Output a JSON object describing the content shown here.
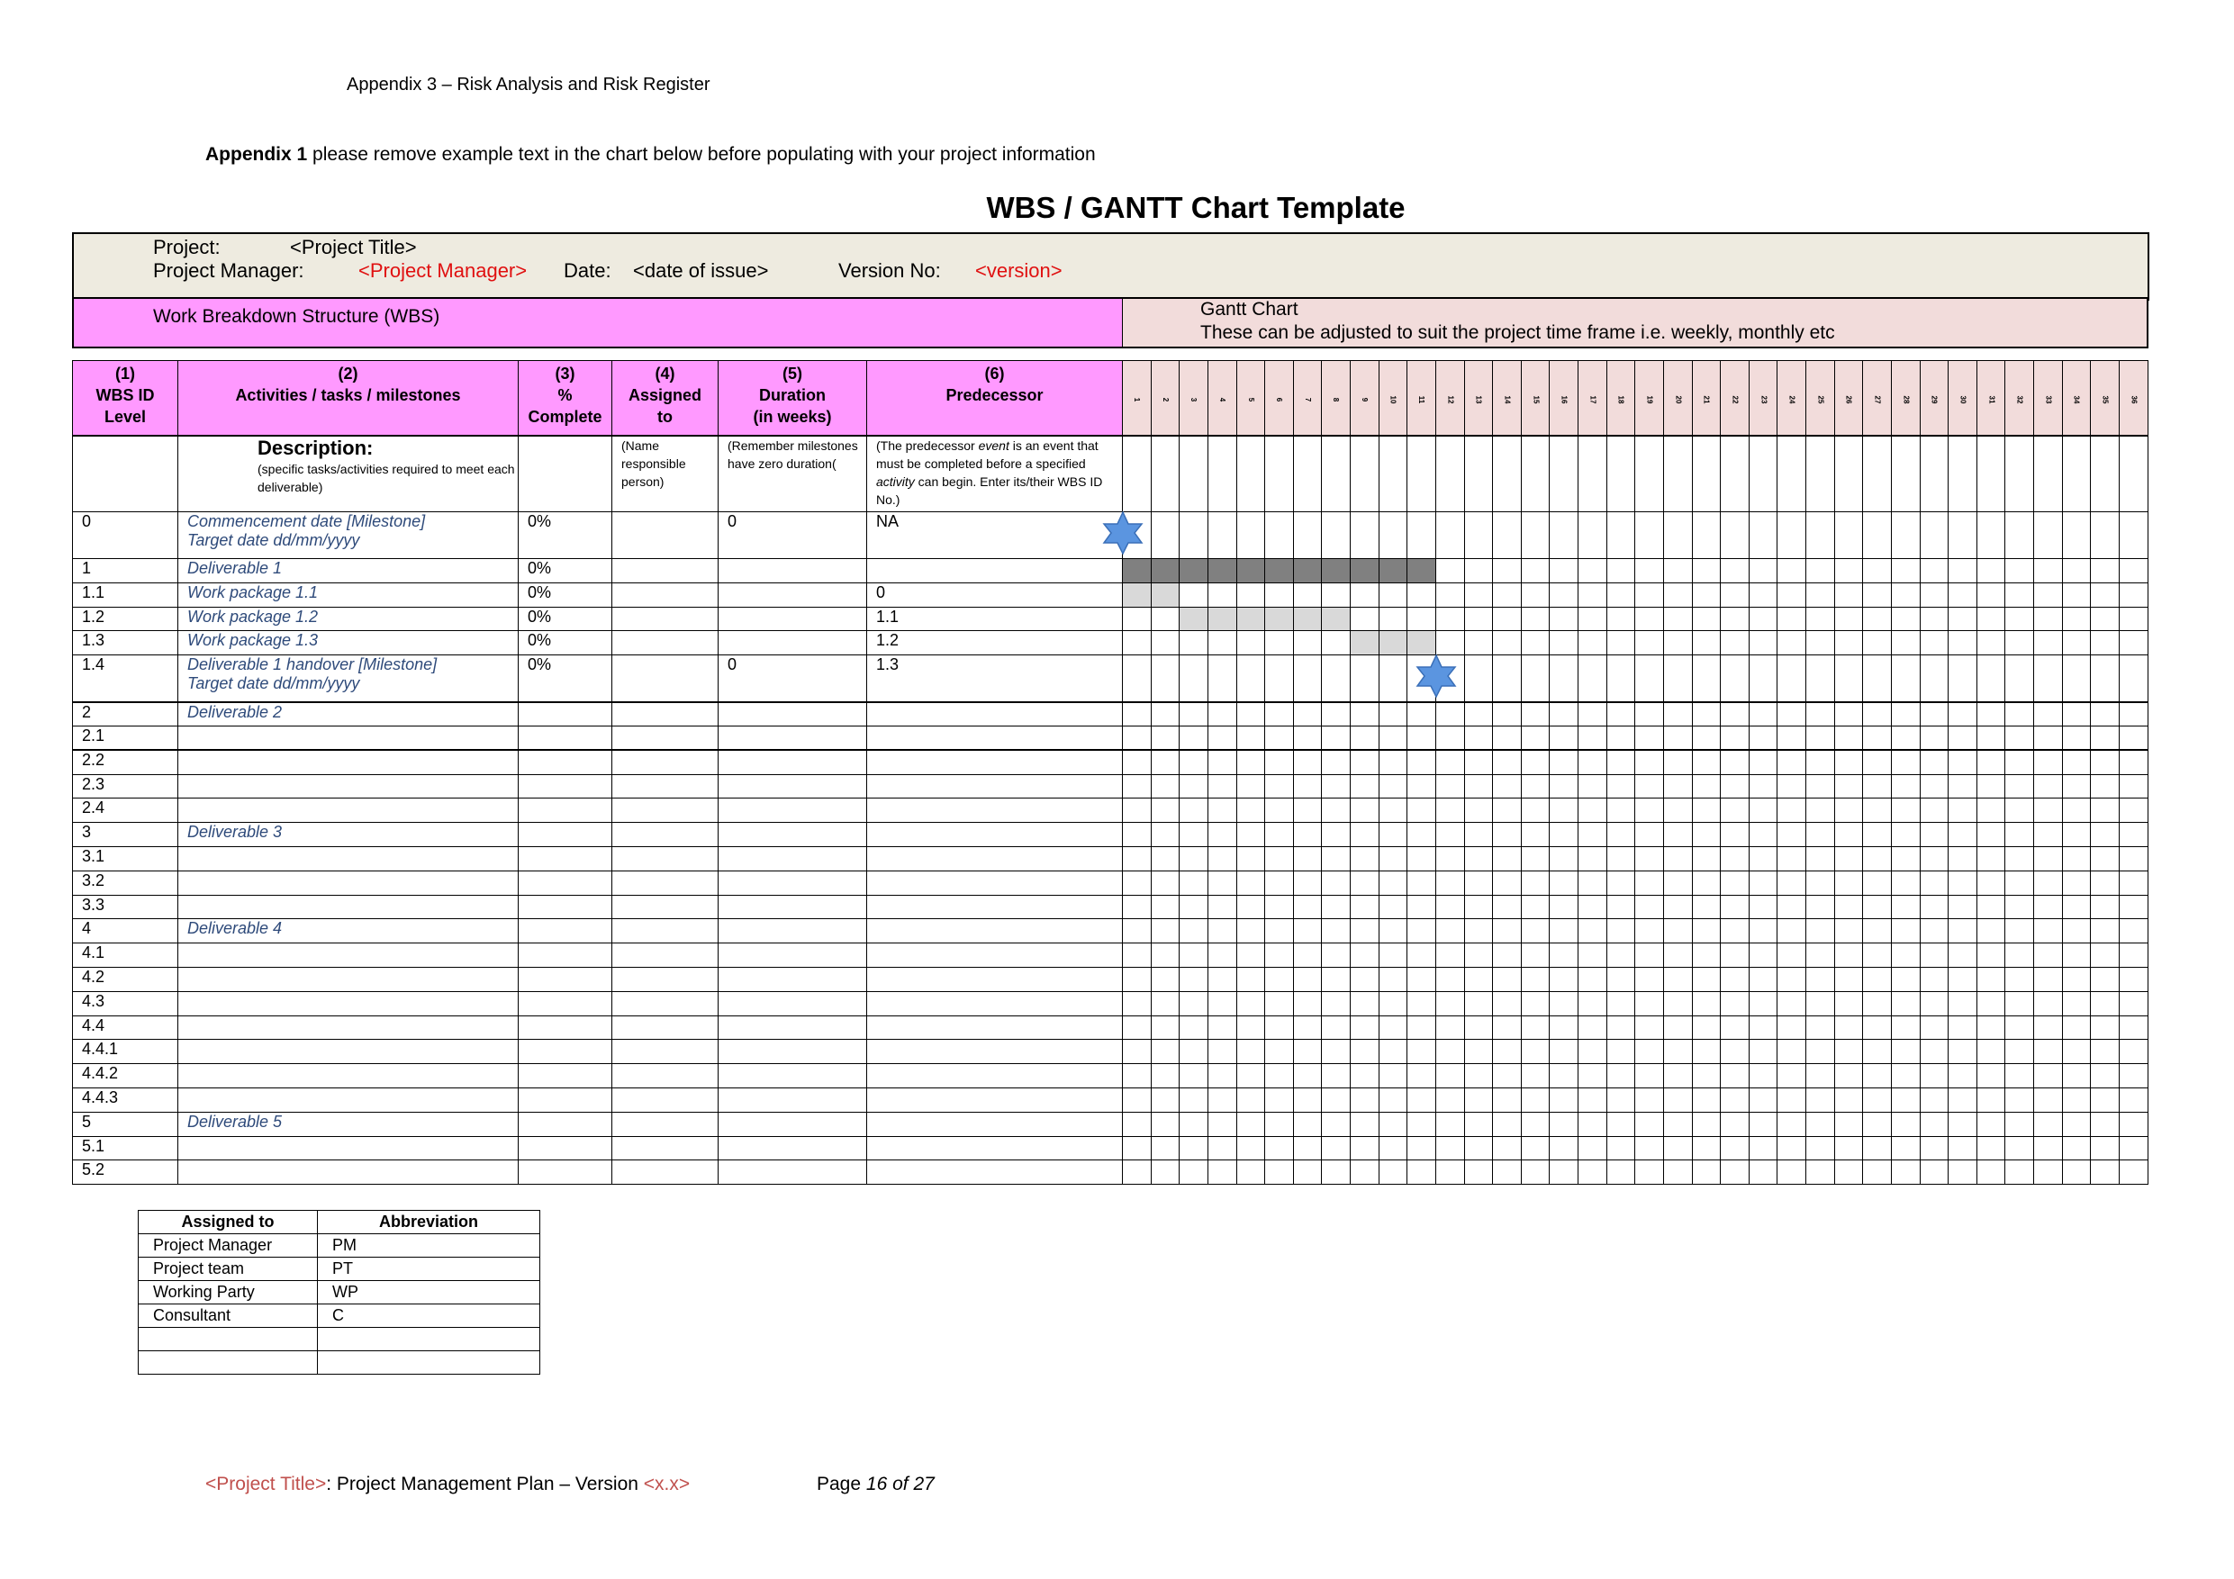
{
  "header": "Appendix 3 – Risk Analysis and Risk Register",
  "intro": {
    "bold": "Appendix 1",
    "text": " please remove example text in the chart below before populating with your project information"
  },
  "title": "WBS / GANTT Chart Template",
  "project": {
    "project_label": "Project:",
    "project_value": "<Project Title>",
    "manager_label": "Project Manager:",
    "manager_value": "<Project Manager>",
    "date_label": "Date:",
    "date_value": "<date of issue>",
    "version_label": "Version No:",
    "version_value": "<version>"
  },
  "wbs_bar": "Work Breakdown Structure (WBS)",
  "gantt_bar": {
    "title": "Gantt Chart",
    "note": "These can be adjusted to suit the project time frame i.e. weekly, monthly etc"
  },
  "columns": [
    [
      "(1)",
      "WBS ID",
      "Level"
    ],
    [
      "(2)",
      "Activities / tasks / milestones",
      ""
    ],
    [
      "(3)",
      "%",
      "Complete"
    ],
    [
      "(4)",
      "Assigned",
      "to"
    ],
    [
      "(5)",
      "Duration",
      "(in weeks)"
    ],
    [
      "(6)",
      "Predecessor",
      ""
    ]
  ],
  "weeks": [
    "1",
    "2",
    "3",
    "4",
    "5",
    "6",
    "7",
    "8",
    "9",
    "10",
    "11",
    "12",
    "13",
    "14",
    "15",
    "16",
    "17",
    "18",
    "19",
    "20",
    "21",
    "22",
    "23",
    "24",
    "25",
    "26",
    "27",
    "28",
    "29",
    "30",
    "31",
    "32",
    "33",
    "34",
    "35",
    "36"
  ],
  "description": {
    "title": "Description:",
    "activities": "(specific tasks/activities required to meet each deliverable)",
    "assigned": "(Name responsible person)",
    "duration": "(Remember milestones have zero duration(",
    "predecessor_1": "(The predecessor ",
    "predecessor_event": "event",
    "predecessor_2": " is an event that must be completed before a specified ",
    "predecessor_activity": "activity",
    "predecessor_3": " can begin. Enter its/their WBS ID No.)"
  },
  "rows": [
    {
      "id": "0",
      "activity": "Commencement date [Milestone]",
      "activity2": "Target date dd/mm/yyyy",
      "pct": "0%",
      "assigned": "",
      "duration": "0",
      "pred": "NA",
      "milestone_week": 0
    },
    {
      "id": "1",
      "activity": "Deliverable 1",
      "pct": "0%",
      "assigned": "",
      "duration": "",
      "pred": "",
      "bar": [
        1,
        11
      ],
      "bar_style": "dark"
    },
    {
      "id": "1.1",
      "activity": "Work package 1.1",
      "pct": "0%",
      "assigned": "",
      "duration": "",
      "pred": "0",
      "bar": [
        1,
        2
      ],
      "bar_style": "light"
    },
    {
      "id": "1.2",
      "activity": "Work package 1.2",
      "pct": "0%",
      "assigned": "",
      "duration": "",
      "pred": "1.1",
      "bar": [
        3,
        8
      ],
      "bar_style": "light"
    },
    {
      "id": "1.3",
      "activity": "Work package 1.3",
      "pct": "0%",
      "assigned": "",
      "duration": "",
      "pred": "1.2",
      "bar": [
        9,
        11
      ],
      "bar_style": "light"
    },
    {
      "id": "1.4",
      "activity": "Deliverable 1 handover [Milestone]",
      "activity2": "Target date dd/mm/yyyy",
      "pct": "0%",
      "assigned": "",
      "duration": "0",
      "pred": "1.3",
      "milestone_week": 11
    },
    {
      "id": "2",
      "activity": "Deliverable 2"
    },
    {
      "id": "2.1"
    },
    {
      "id": "2.2"
    },
    {
      "id": "2.3"
    },
    {
      "id": "2.4"
    },
    {
      "id": "3",
      "activity": "Deliverable 3"
    },
    {
      "id": "3.1"
    },
    {
      "id": "3.2"
    },
    {
      "id": "3.3"
    },
    {
      "id": "4",
      "activity": "Deliverable 4"
    },
    {
      "id": "4.1"
    },
    {
      "id": "4.2"
    },
    {
      "id": "4.3"
    },
    {
      "id": "4.4"
    },
    {
      "id": "4.4.1"
    },
    {
      "id": "4.4.2"
    },
    {
      "id": "4.4.3"
    },
    {
      "id": "5",
      "activity": "Deliverable 5"
    },
    {
      "id": "5.1"
    },
    {
      "id": "5.2"
    }
  ],
  "abbreviations": {
    "headers": [
      "Assigned to",
      "Abbreviation"
    ],
    "rows": [
      [
        "Project Manager",
        "PM"
      ],
      [
        "Project team",
        "PT"
      ],
      [
        "Working Party",
        "WP"
      ],
      [
        "Consultant",
        "C"
      ],
      [
        "",
        ""
      ],
      [
        "",
        ""
      ]
    ]
  },
  "footer": {
    "title": "<Project Title>",
    "text": ": Project Management Plan – Version ",
    "version": "<x.x>"
  },
  "page": {
    "label": "Page ",
    "current": "16",
    "of": " of ",
    "total": "27"
  },
  "colors": {
    "wbs_pink": "#ff99ff",
    "gantt_pink": "#f2dcdb",
    "project_bg": "#eeebe0",
    "bar_dark": "#808080",
    "bar_light": "#d9d9d9",
    "milestone_star": "#4a86d8",
    "placeholder_red": "#e01010"
  }
}
